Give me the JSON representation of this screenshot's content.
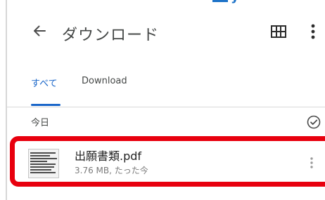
{
  "appbar": {
    "title": "ダウンロード",
    "back_icon": "back-arrow-icon",
    "grid_icon": "grid-view-icon",
    "more_icon": "more-vert-icon"
  },
  "tabs": [
    {
      "label": "すべて",
      "selected": true
    },
    {
      "label": "Download",
      "selected": false
    }
  ],
  "section": {
    "label": "今日",
    "select_icon": "check-circle-icon"
  },
  "files": [
    {
      "name": "出願書類.pdf",
      "meta": "3.76 MB, たった今",
      "thumb_icon": "document-thumbnail",
      "more_icon": "more-vert-icon"
    }
  ],
  "colors": {
    "accent": "#1a66c9",
    "highlight": "#e8000e",
    "text_primary": "#1f1f1f",
    "text_secondary": "#7a7a7a"
  }
}
